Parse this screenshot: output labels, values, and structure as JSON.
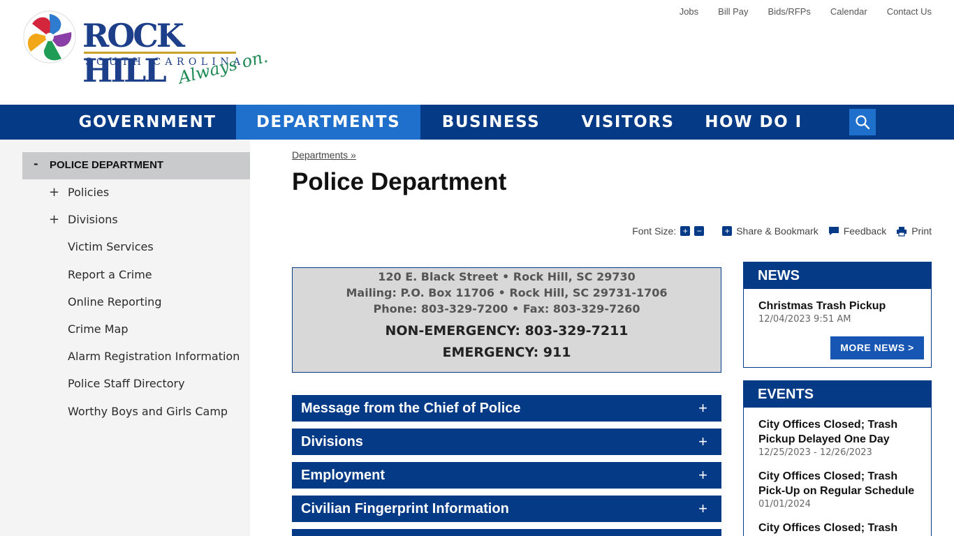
{
  "logo": {
    "word": "ROCK HILL",
    "state": "SOUTH CAROLINA",
    "tagline": "Always on."
  },
  "utility_nav": [
    "Jobs",
    "Bill Pay",
    "Bids/RFPs",
    "Calendar",
    "Contact Us"
  ],
  "main_nav": {
    "items": [
      "GOVERNMENT",
      "DEPARTMENTS",
      "BUSINESS",
      "VISITORS",
      "HOW DO I ..."
    ],
    "active": "DEPARTMENTS"
  },
  "sidebar": {
    "heading": "POLICE DEPARTMENT",
    "heading_marker": "-",
    "items": [
      {
        "label": "Policies",
        "expandable": "+"
      },
      {
        "label": "Divisions",
        "expandable": "+"
      },
      {
        "label": "Victim Services"
      },
      {
        "label": "Report a Crime"
      },
      {
        "label": "Online Reporting"
      },
      {
        "label": "Crime Map"
      },
      {
        "label": "Alarm Registration Information"
      },
      {
        "label": "Police Staff Directory"
      },
      {
        "label": "Worthy Boys and Girls Camp"
      }
    ]
  },
  "breadcrumb": "Departments »",
  "page_title": "Police Department",
  "tools": {
    "font_size_label": "Font Size:",
    "increase": "+",
    "decrease": "−",
    "share": "Share & Bookmark",
    "feedback": "Feedback",
    "print": "Print"
  },
  "contact": {
    "address": "120 E. Black Street • Rock Hill, SC 29730",
    "mailing": "Mailing: P.O. Box 11706 • Rock Hill, SC 29731-1706",
    "phone": "Phone: 803-329-7200 • Fax: 803-329-7260",
    "non_emergency": "NON-EMERGENCY: 803-329-7211",
    "emergency": "EMERGENCY: 911"
  },
  "accordion": [
    {
      "title": "Message from the Chief of Police",
      "toggle": "+"
    },
    {
      "title": "Divisions",
      "toggle": "+"
    },
    {
      "title": "Employment",
      "toggle": "+"
    },
    {
      "title": "Civilian Fingerprint Information",
      "toggle": "+"
    }
  ],
  "news": {
    "heading": "NEWS",
    "items": [
      {
        "title": "Christmas Trash Pickup",
        "date": "12/04/2023 9:51 AM"
      }
    ],
    "more_button": "MORE NEWS >"
  },
  "events": {
    "heading": "EVENTS",
    "items": [
      {
        "title": "City Offices Closed; Trash Pickup Delayed One Day",
        "date": "12/25/2023 - 12/26/2023"
      },
      {
        "title": "City Offices Closed; Trash Pick-Up on Regular Schedule",
        "date": "01/01/2024"
      },
      {
        "title": "City Offices Closed; Trash",
        "date": ""
      }
    ]
  },
  "colors": {
    "nav_blue": "#053a86",
    "active_blue": "#1f6fcc",
    "sidebar_bg": "#f4f4f4",
    "contact_bg": "#d8d8d8"
  }
}
